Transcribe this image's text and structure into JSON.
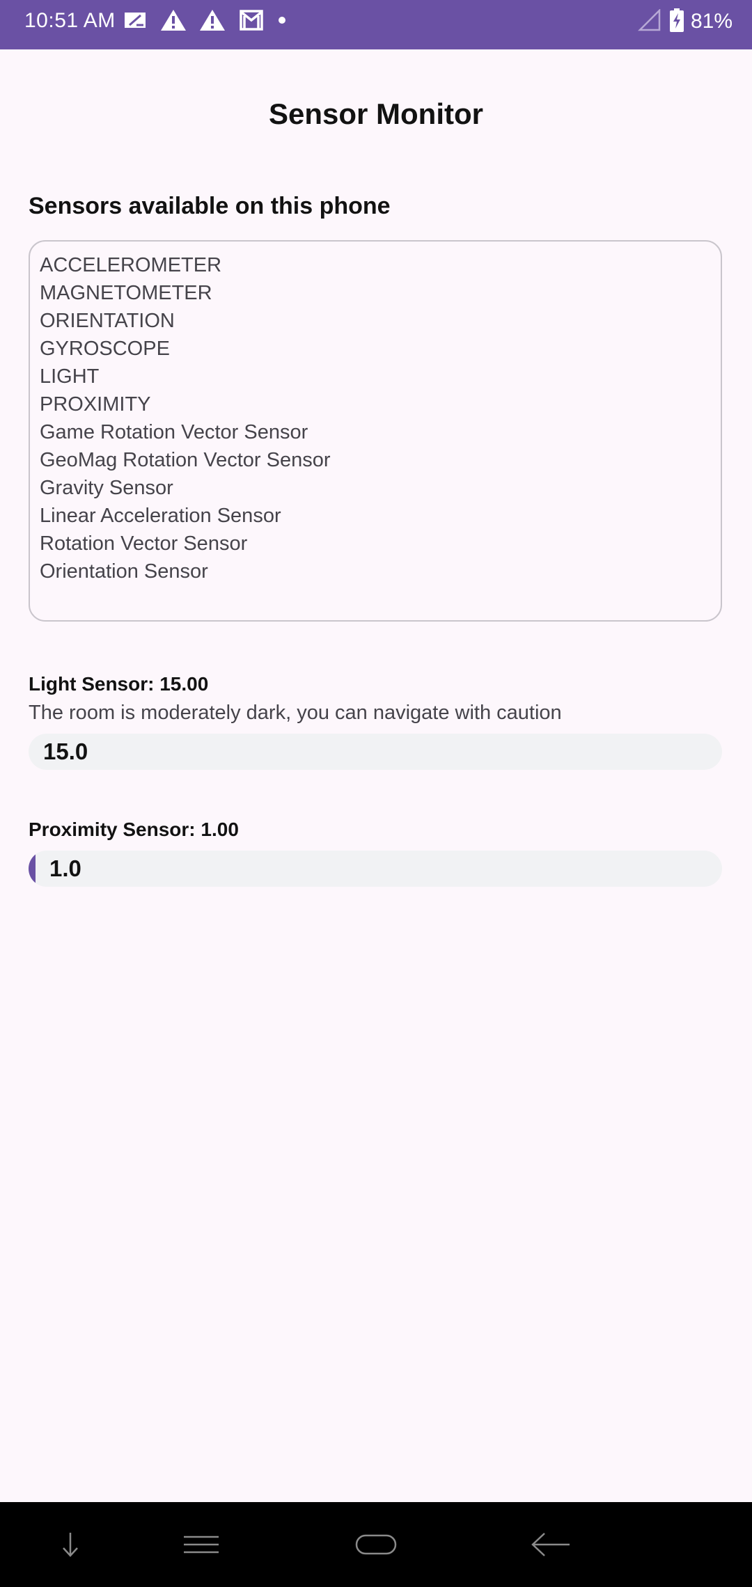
{
  "status_bar": {
    "time": "10:51 AM",
    "battery_percent": "81%",
    "icons_left": [
      "sim-card-icon",
      "warning-icon",
      "warning-icon",
      "gmail-icon",
      "dot-icon"
    ],
    "icons_right": [
      "signal-icon",
      "battery-charging-icon"
    ],
    "background_color": "#6a51a4"
  },
  "app": {
    "title": "Sensor Monitor",
    "sensors_heading": "Sensors available on this phone",
    "sensors": [
      "ACCELEROMETER",
      "MAGNETOMETER",
      "ORIENTATION",
      "GYROSCOPE",
      "LIGHT",
      "PROXIMITY",
      "Game Rotation Vector Sensor",
      "GeoMag Rotation Vector Sensor",
      "Gravity Sensor",
      "Linear Acceleration Sensor",
      "Rotation Vector Sensor",
      "Orientation Sensor"
    ],
    "light": {
      "label": "Light Sensor: 15.00",
      "description": "The room is moderately dark, you can navigate with caution",
      "bar_value": "15.0",
      "fill_fraction": 0.0
    },
    "proximity": {
      "label": "Proximity Sensor: 1.00",
      "bar_value": "1.0",
      "fill_fraction": 0.01
    },
    "accent_color": "#6a51a4"
  },
  "nav_bar": {
    "buttons": [
      "down-arrow-icon",
      "menu-icon",
      "home-icon",
      "back-icon"
    ]
  }
}
